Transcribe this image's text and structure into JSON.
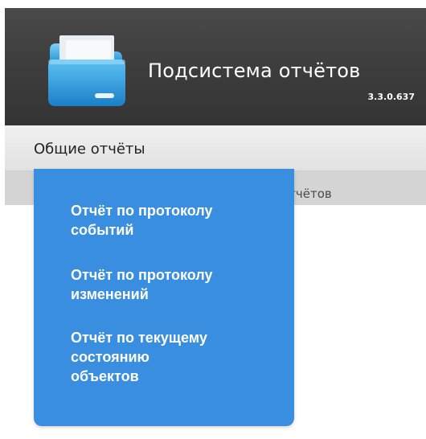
{
  "app": {
    "title": "Подсистема отчётов",
    "version": "3.3.0.637",
    "icon": "folder-icon"
  },
  "menubar": {
    "items": [
      {
        "label": "Общие отчёты"
      }
    ]
  },
  "tabbar": {
    "partial_label": "отчётов"
  },
  "dropdown": {
    "items": [
      {
        "lines": [
          "Отчёт по протоколу",
          "событий"
        ]
      },
      {
        "lines": [
          "Отчёт по протоколу",
          "изменений"
        ]
      },
      {
        "lines": [
          "Отчёт по текущему",
          "состоянию",
          "объектов"
        ]
      }
    ]
  },
  "colors": {
    "header_bg": "#3c3c3c",
    "menubar_bg": "#e8e8e8",
    "tabbar_bg": "#d4d4d4",
    "dropdown_bg": "#3a8ee0",
    "dropdown_text": "#ffffff"
  }
}
